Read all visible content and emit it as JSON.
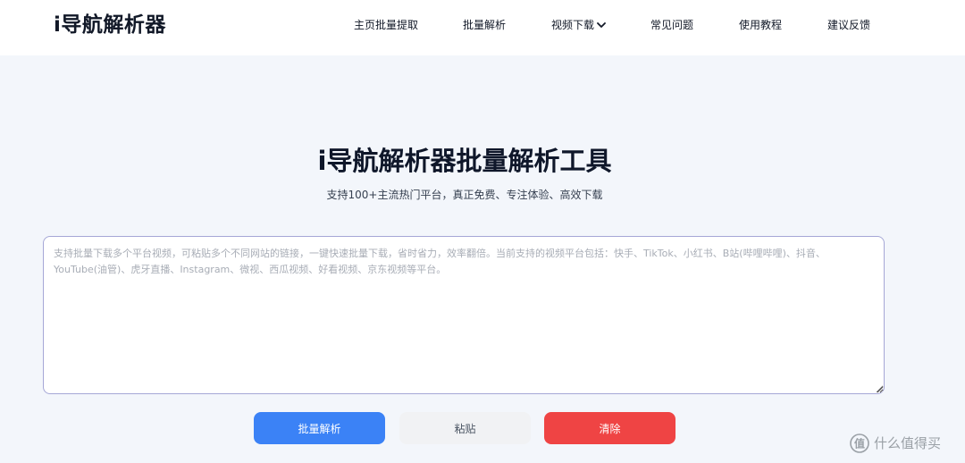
{
  "header": {
    "logo": "i导航解析器",
    "nav": [
      {
        "label": "主页批量提取"
      },
      {
        "label": "批量解析"
      },
      {
        "label": "视频下载"
      },
      {
        "label": "常见问题"
      },
      {
        "label": "使用教程"
      },
      {
        "label": "建议反馈"
      }
    ]
  },
  "hero": {
    "title": "i导航解析器批量解析工具",
    "subtitle": "支持100+主流热门平台，真正免费、专注体验、高效下载"
  },
  "input": {
    "placeholder": "支持批量下载多个平台视频，可粘贴多个不同网站的链接，一键快速批量下载，省时省力，效率翻倍。当前支持的视频平台包括：快手、TikTok、小红书、B站(哔哩哔哩)、抖音、YouTube(油管)、虎牙直播、Instagram、微视、西瓜视频、好看视频、京东视频等平台。",
    "value": ""
  },
  "buttons": {
    "parse": "批量解析",
    "paste": "粘贴",
    "clear": "清除"
  },
  "watermark": {
    "text": "什么值得买"
  },
  "colors": {
    "primary": "#3b82f6",
    "danger": "#ef4444",
    "background": "#f3f6fb",
    "border": "#a5a7d6"
  },
  "icons": {
    "nav_dropdown": "chevron-down-icon",
    "watermark_logo": "smzdm-logo-icon",
    "resize": "resize-grip-icon"
  }
}
